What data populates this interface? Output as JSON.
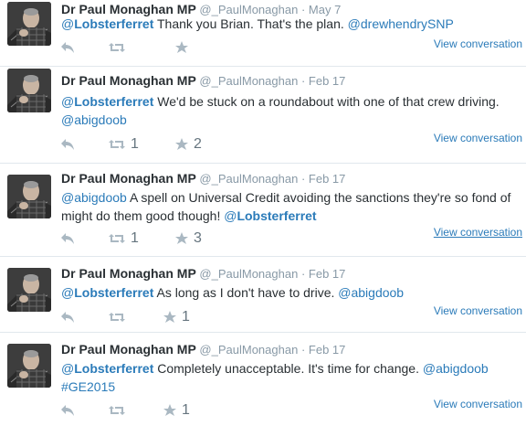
{
  "tweets": [
    {
      "name": "Dr Paul Monaghan MP",
      "handle": "@_PaulMonaghan",
      "separator": "·",
      "date": "May 7",
      "text_before": "",
      "mention1": "@Lobsterferret",
      "text_after": " Thank you Brian. That's the plan. ",
      "mention2": "@drewhendrySNP",
      "retweets": "",
      "favorites": "",
      "view": "View conversation"
    },
    {
      "name": "Dr Paul Monaghan MP",
      "handle": "@_PaulMonaghan",
      "separator": "·",
      "date": "Feb 17",
      "mention1": "@Lobsterferret",
      "text_after": " We'd be stuck on a roundabout with one of that crew driving.",
      "mention2": "@abigdoob",
      "retweets": "1",
      "favorites": "2",
      "view": "View conversation"
    },
    {
      "name": "Dr Paul Monaghan MP",
      "handle": "@_PaulMonaghan",
      "separator": "·",
      "date": "Feb 17",
      "mention1": "@abigdoob",
      "text_after": " A spell on Universal Credit avoiding the sanctions they're so fond of might do them good though! ",
      "mention2": "@Lobsterferret",
      "retweets": "1",
      "favorites": "3",
      "view": "View conversation"
    },
    {
      "name": "Dr Paul Monaghan MP",
      "handle": "@_PaulMonaghan",
      "separator": "·",
      "date": "Feb 17",
      "mention1": "@Lobsterferret",
      "text_after": " As long as I don't have to drive. ",
      "mention2": "@abigdoob",
      "retweets": "",
      "favorites": "1",
      "view": "View conversation"
    },
    {
      "name": "Dr Paul Monaghan MP",
      "handle": "@_PaulMonaghan",
      "separator": "·",
      "date": "Feb 17",
      "mention1": "@Lobsterferret",
      "text_after": " Completely unacceptable. It's time for change. ",
      "mention2": "@abigdoob",
      "hashtag": "#GE2015",
      "retweets": "",
      "favorites": "1",
      "view": "View conversation"
    }
  ],
  "colors": {
    "link": "#2b7bb9",
    "muted": "#8899a6",
    "icon": "#aab8c2",
    "text": "#292f33"
  },
  "icons": {
    "reply": "reply-icon",
    "retweet": "retweet-icon",
    "favorite": "star-icon"
  }
}
